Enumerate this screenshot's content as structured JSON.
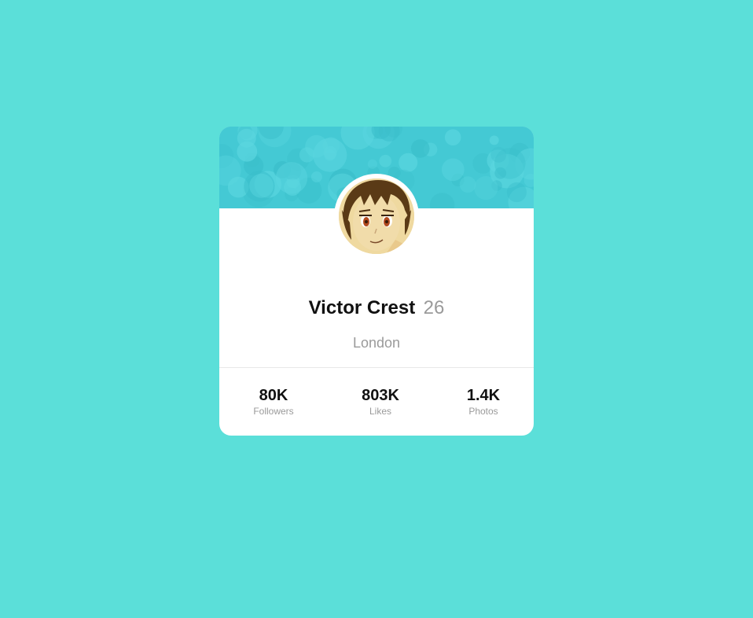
{
  "profile": {
    "name": "Victor Crest",
    "age": "26",
    "city": "London",
    "avatar_icon": "anime-boy-avatar"
  },
  "stats": [
    {
      "value": "80K",
      "label": "Followers"
    },
    {
      "value": "803K",
      "label": "Likes"
    },
    {
      "value": "1.4K",
      "label": "Photos"
    }
  ],
  "colors": {
    "page_background": "#5bdfd9",
    "banner": "#44c9d4",
    "card": "#ffffff",
    "primary_text": "#111111",
    "secondary_text": "#9a9a9a"
  }
}
